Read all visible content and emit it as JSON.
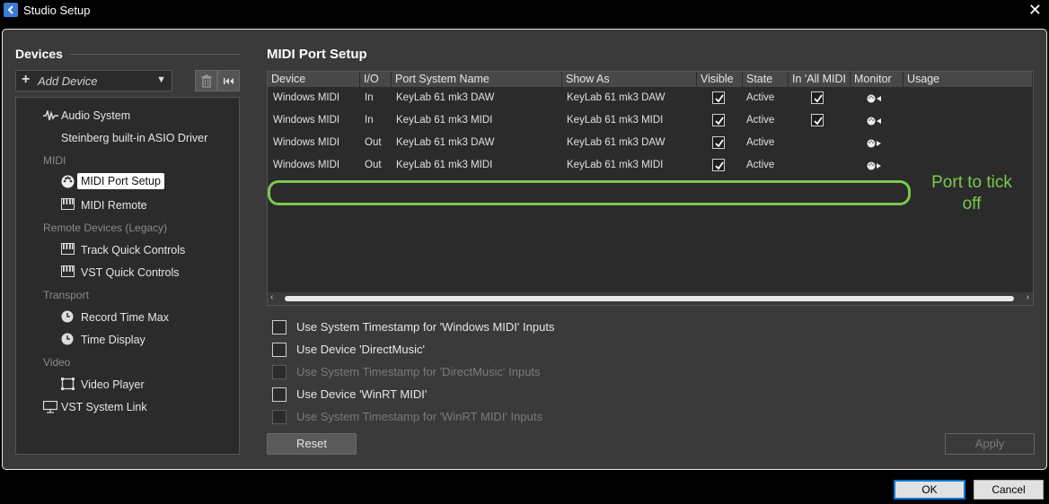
{
  "window": {
    "title": "Studio Setup",
    "close_glyph": "✕"
  },
  "devices": {
    "heading": "Devices",
    "add_device": "Add Device",
    "add_plus": "+",
    "dropdown_arrow": "▼",
    "tree": {
      "audio_system": "Audio System",
      "asio_driver": "Steinberg built-in ASIO Driver",
      "cat_midi": "MIDI",
      "midi_port_setup": "MIDI Port Setup",
      "midi_remote": "MIDI Remote",
      "cat_remote": "Remote Devices (Legacy)",
      "track_quick_controls": "Track Quick Controls",
      "vst_quick_controls": "VST Quick Controls",
      "cat_transport": "Transport",
      "record_time_max": "Record Time Max",
      "time_display": "Time Display",
      "cat_video": "Video",
      "video_player": "Video Player",
      "vst_system_link": "VST System Link"
    }
  },
  "midi_port_setup": {
    "title": "MIDI Port Setup",
    "columns": [
      "Device",
      "I/O",
      "Port System Name",
      "Show As",
      "Visible",
      "State",
      "In 'All MIDI",
      "Monitor",
      "Usage"
    ],
    "rows": [
      {
        "device": "Windows MIDI",
        "io": "In",
        "port": "KeyLab 61 mk3 DAW",
        "show_as": "KeyLab 61 mk3 DAW",
        "visible": true,
        "state": "Active",
        "all_midi": true,
        "monitor_icon": "midi-in-monitor-icon"
      },
      {
        "device": "Windows MIDI",
        "io": "In",
        "port": "KeyLab 61 mk3 MIDI",
        "show_as": "KeyLab 61 mk3 MIDI",
        "visible": true,
        "state": "Active",
        "all_midi": true,
        "monitor_icon": "midi-in-monitor-icon"
      },
      {
        "device": "Windows MIDI",
        "io": "Out",
        "port": "KeyLab 61 mk3 DAW",
        "show_as": "KeyLab 61 mk3 DAW",
        "visible": true,
        "state": "Active",
        "all_midi": false,
        "monitor_icon": "midi-out-monitor-icon"
      },
      {
        "device": "Windows MIDI",
        "io": "Out",
        "port": "KeyLab 61 mk3 MIDI",
        "show_as": "KeyLab 61 mk3 MIDI",
        "visible": true,
        "state": "Active",
        "all_midi": false,
        "monitor_icon": "midi-out-monitor-icon"
      }
    ],
    "annotation": "Port to tick off",
    "annotation_color": "#7bc94c",
    "options": [
      {
        "label": "Use System Timestamp for 'Windows MIDI' Inputs",
        "enabled": true,
        "checked": false
      },
      {
        "label": "Use Device 'DirectMusic'",
        "enabled": true,
        "checked": false
      },
      {
        "label": "Use System Timestamp for 'DirectMusic' Inputs",
        "enabled": false,
        "checked": false
      },
      {
        "label": "Use Device 'WinRT MIDI'",
        "enabled": true,
        "checked": false
      },
      {
        "label": "Use System Timestamp for 'WinRT MIDI' Inputs",
        "enabled": false,
        "checked": false
      }
    ],
    "reset": "Reset",
    "apply": "Apply"
  },
  "footer": {
    "ok": "OK",
    "cancel": "Cancel"
  },
  "colors": {
    "accent_blue": "#0078d7",
    "panel": "#3a3a3a",
    "list_bg": "#2b2b2b"
  }
}
